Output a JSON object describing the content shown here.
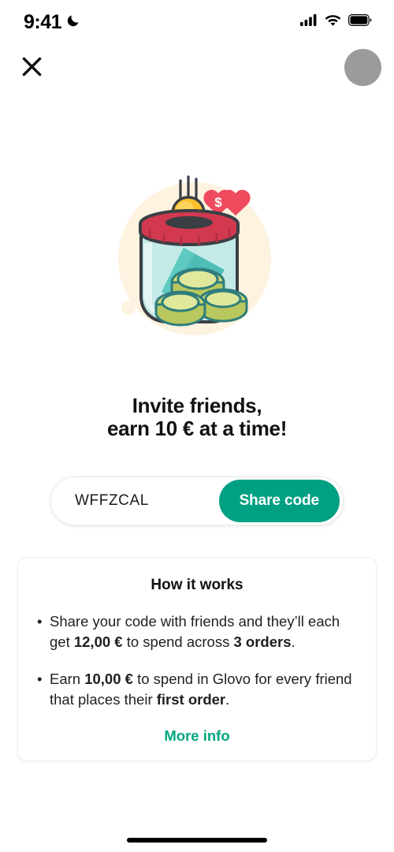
{
  "status_bar": {
    "time": "9:41",
    "dnd_icon": "moon-icon",
    "cellular_icon": "cellular-bars-icon",
    "wifi_icon": "wifi-icon",
    "battery_icon": "battery-full-icon"
  },
  "topbar": {
    "close_icon": "close-icon",
    "avatar_label": ""
  },
  "illustration": {
    "name": "money-jar-illustration",
    "background_circle_color": "#fdf3e0",
    "lid_color": "#d2394f",
    "jar_color": "#a9e0dc",
    "coin_gold_color": "#fcc02c",
    "coin_green_color": "#ccd873",
    "banknote_color": "#4dbdb5",
    "heart_color": "#ef4a5e",
    "heart_symbol": "$",
    "outline_color": "#3b3f44"
  },
  "headline": {
    "line1": "Invite friends,",
    "line2": "earn 10 € at a time!"
  },
  "referral": {
    "code": "WFFZCAL",
    "share_label": "Share code",
    "accent_color": "#00a082"
  },
  "info_card": {
    "title": "How it works",
    "bullets": [
      {
        "parts": [
          {
            "text": "Share your code with friends and they’ll each get ",
            "bold": false
          },
          {
            "text": "12,00 €",
            "bold": true
          },
          {
            "text": " to spend across ",
            "bold": false
          },
          {
            "text": "3 orders",
            "bold": true
          },
          {
            "text": ".",
            "bold": false
          }
        ]
      },
      {
        "parts": [
          {
            "text": "Earn ",
            "bold": false
          },
          {
            "text": "10,00 €",
            "bold": true
          },
          {
            "text": " to spend in Glovo for every friend that places their ",
            "bold": false
          },
          {
            "text": "first order",
            "bold": true
          },
          {
            "text": ".",
            "bold": false
          }
        ]
      }
    ],
    "more_info_label": "More info",
    "link_color": "#00a87e"
  },
  "home_indicator": {
    "name": "home-indicator"
  }
}
